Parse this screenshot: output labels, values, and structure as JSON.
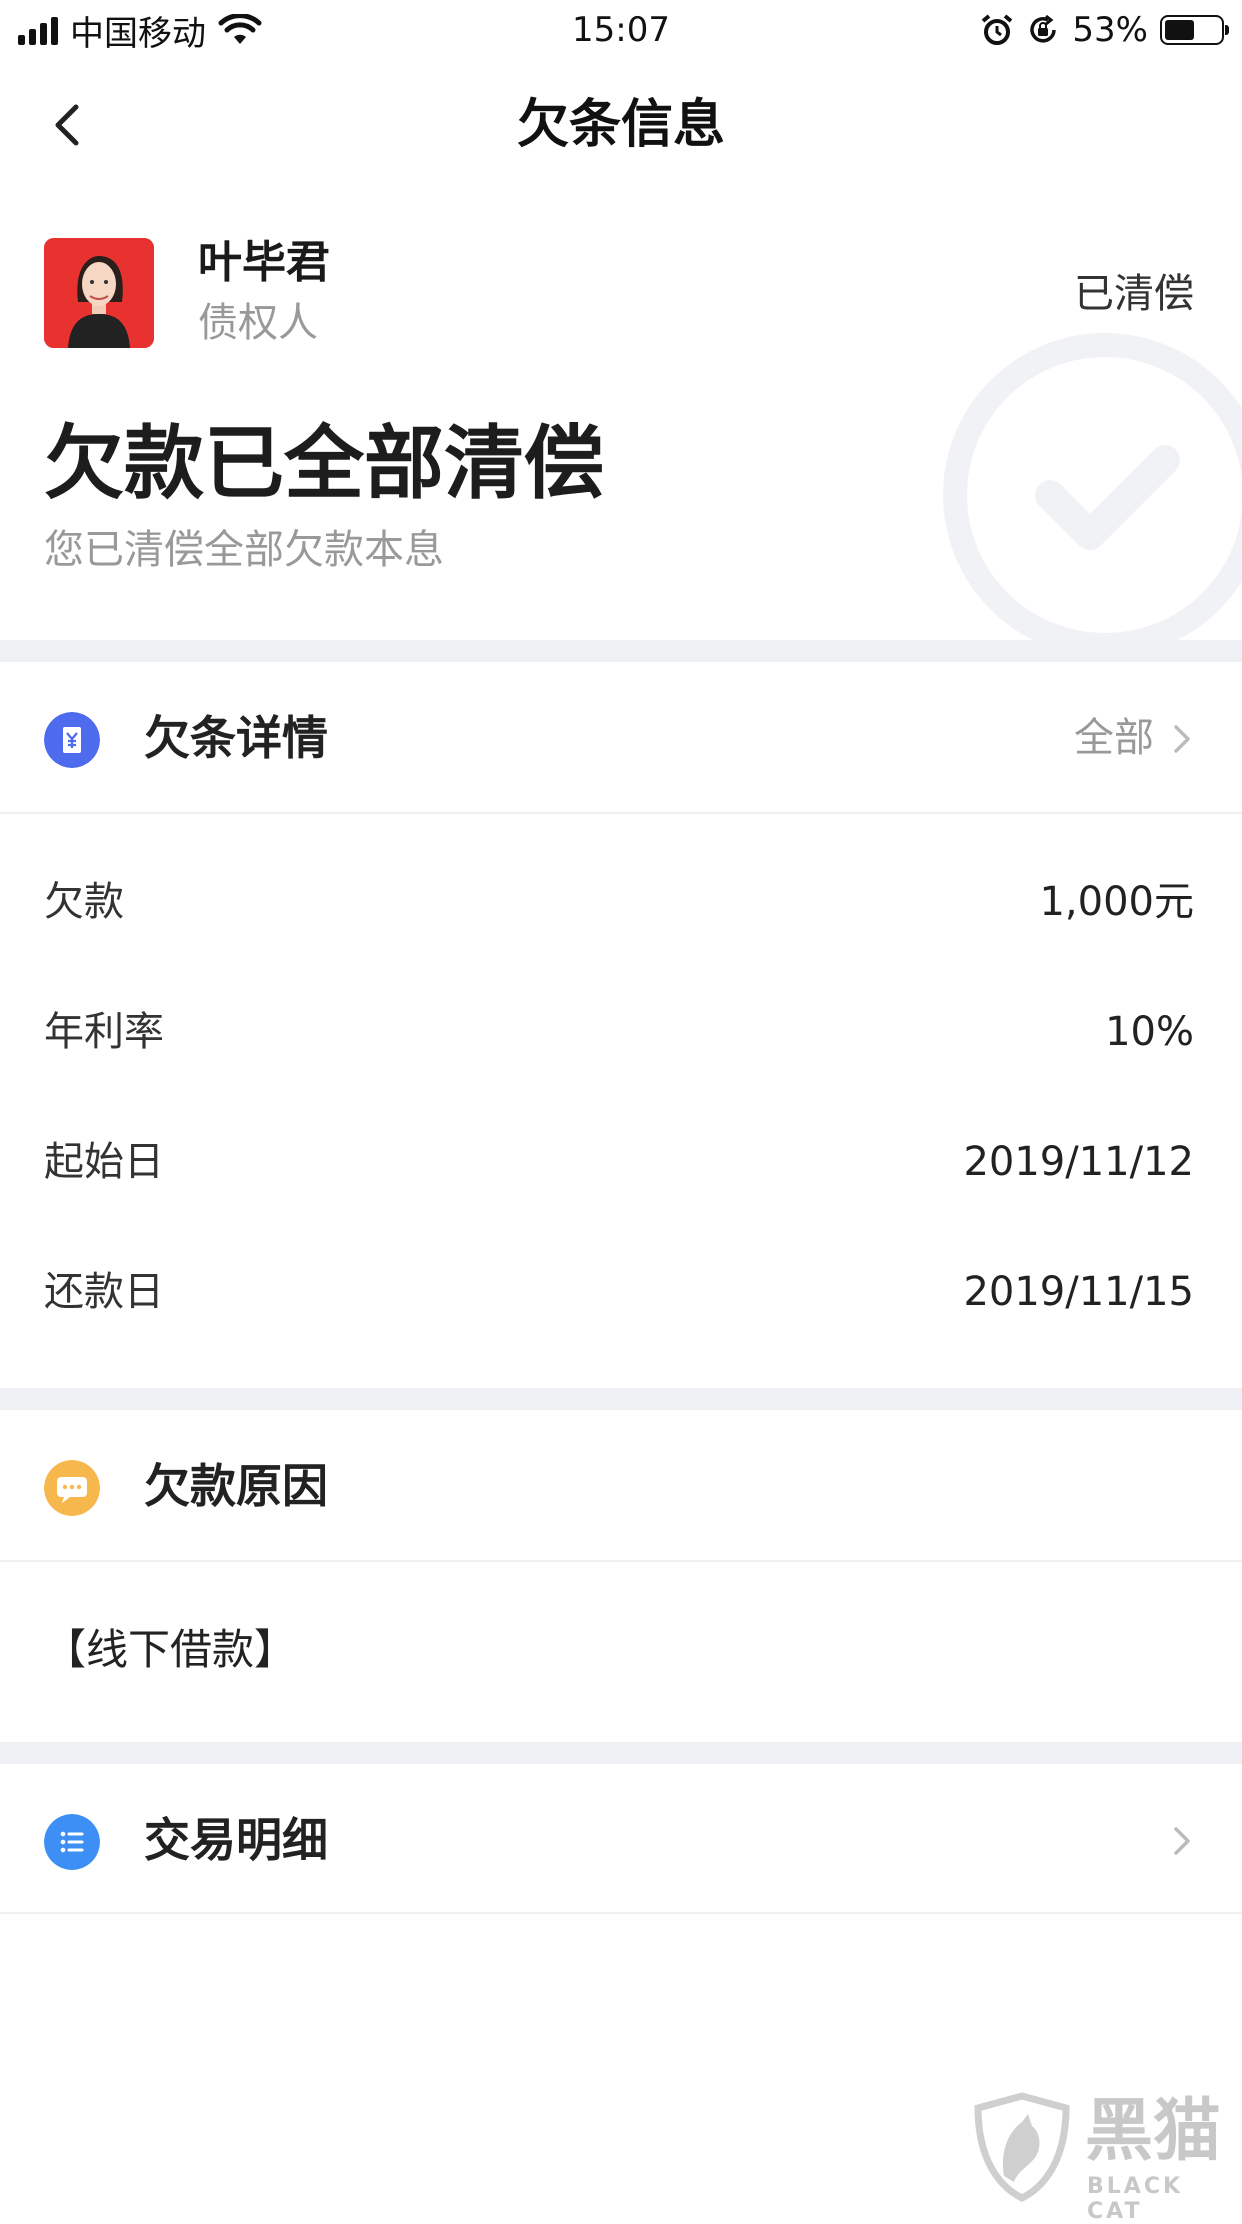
{
  "status_bar": {
    "carrier": "中国移动",
    "time": "15:07",
    "battery_percent": "53%",
    "battery_level": 0.53,
    "icons": [
      "signal-icon",
      "wifi-icon",
      "alarm-icon",
      "rotation-lock-icon",
      "battery-icon"
    ]
  },
  "nav": {
    "title": "欠条信息",
    "back_icon": "chevron-left-icon"
  },
  "header": {
    "creditor_name": "叶毕君",
    "creditor_role": "债权人",
    "status": "已清偿",
    "headline": "欠款已全部清偿",
    "subline": "您已清偿全部欠款本息",
    "decor_icon": "check-circle-icon"
  },
  "details": {
    "title": "欠条详情",
    "link": "全部",
    "icon": "receipt-yen-icon",
    "icon_color": "#4f6bed",
    "rows": [
      {
        "label": "欠款",
        "value": "1,000元"
      },
      {
        "label": "年利率",
        "value": "10%"
      },
      {
        "label": "起始日",
        "value": "2019/11/12"
      },
      {
        "label": "还款日",
        "value": "2019/11/15"
      }
    ]
  },
  "reason": {
    "title": "欠款原因",
    "icon": "message-dots-icon",
    "icon_color": "#f6b84d",
    "text": "【线下借款】"
  },
  "transactions": {
    "title": "交易明细",
    "icon": "list-icon",
    "icon_color": "#3d8ff5"
  },
  "watermark": {
    "text": "黑猫",
    "sub": "BLACK CAT"
  }
}
